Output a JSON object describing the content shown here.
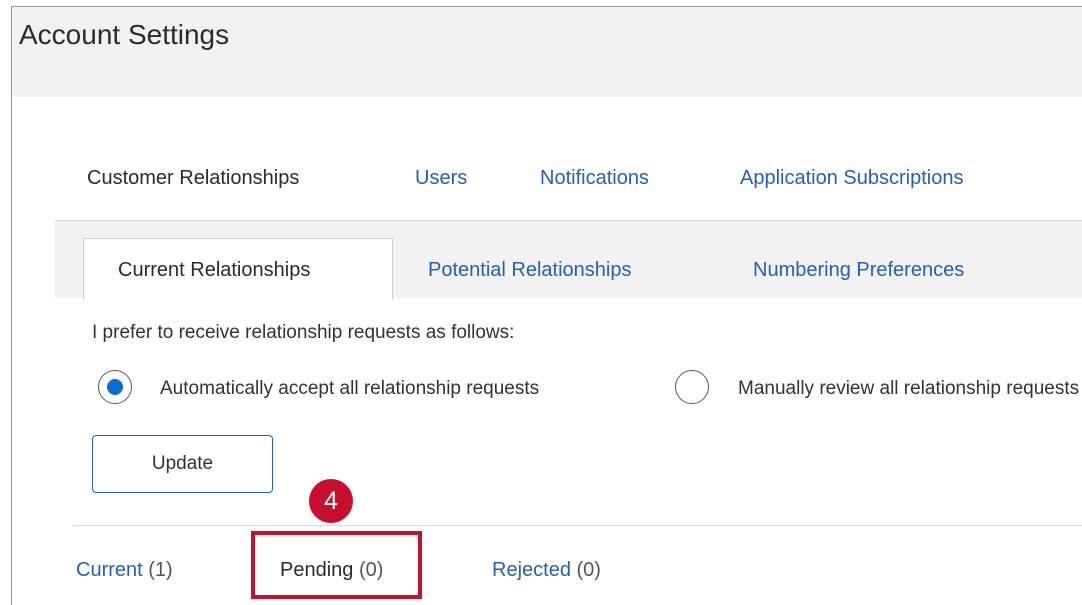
{
  "header": {
    "title": "Account Settings"
  },
  "top_tabs": [
    {
      "label": "Customer Relationships",
      "active": true
    },
    {
      "label": "Users",
      "active": false
    },
    {
      "label": "Notifications",
      "active": false
    },
    {
      "label": "Application Subscriptions",
      "active": false
    }
  ],
  "sub_tabs": [
    {
      "label": "Current Relationships",
      "active": true
    },
    {
      "label": "Potential Relationships",
      "active": false
    },
    {
      "label": "Numbering Preferences",
      "active": false
    }
  ],
  "preferences": {
    "prompt": "I prefer to receive relationship requests as follows:",
    "options": [
      {
        "label": "Automatically accept all relationship requests",
        "checked": true
      },
      {
        "label": "Manually review all relationship requests",
        "checked": false
      }
    ],
    "update_label": "Update"
  },
  "filter_tabs": [
    {
      "label": "Current",
      "count": "(1)"
    },
    {
      "label": "Pending",
      "count": "(0)"
    },
    {
      "label": "Rejected",
      "count": "(0)"
    }
  ],
  "annotation": {
    "step": "4",
    "color": "#c8102e"
  },
  "colors": {
    "link": "#1f62b8",
    "radio_selected": "#0a6ed1",
    "header_bg": "#f2f2f2"
  }
}
